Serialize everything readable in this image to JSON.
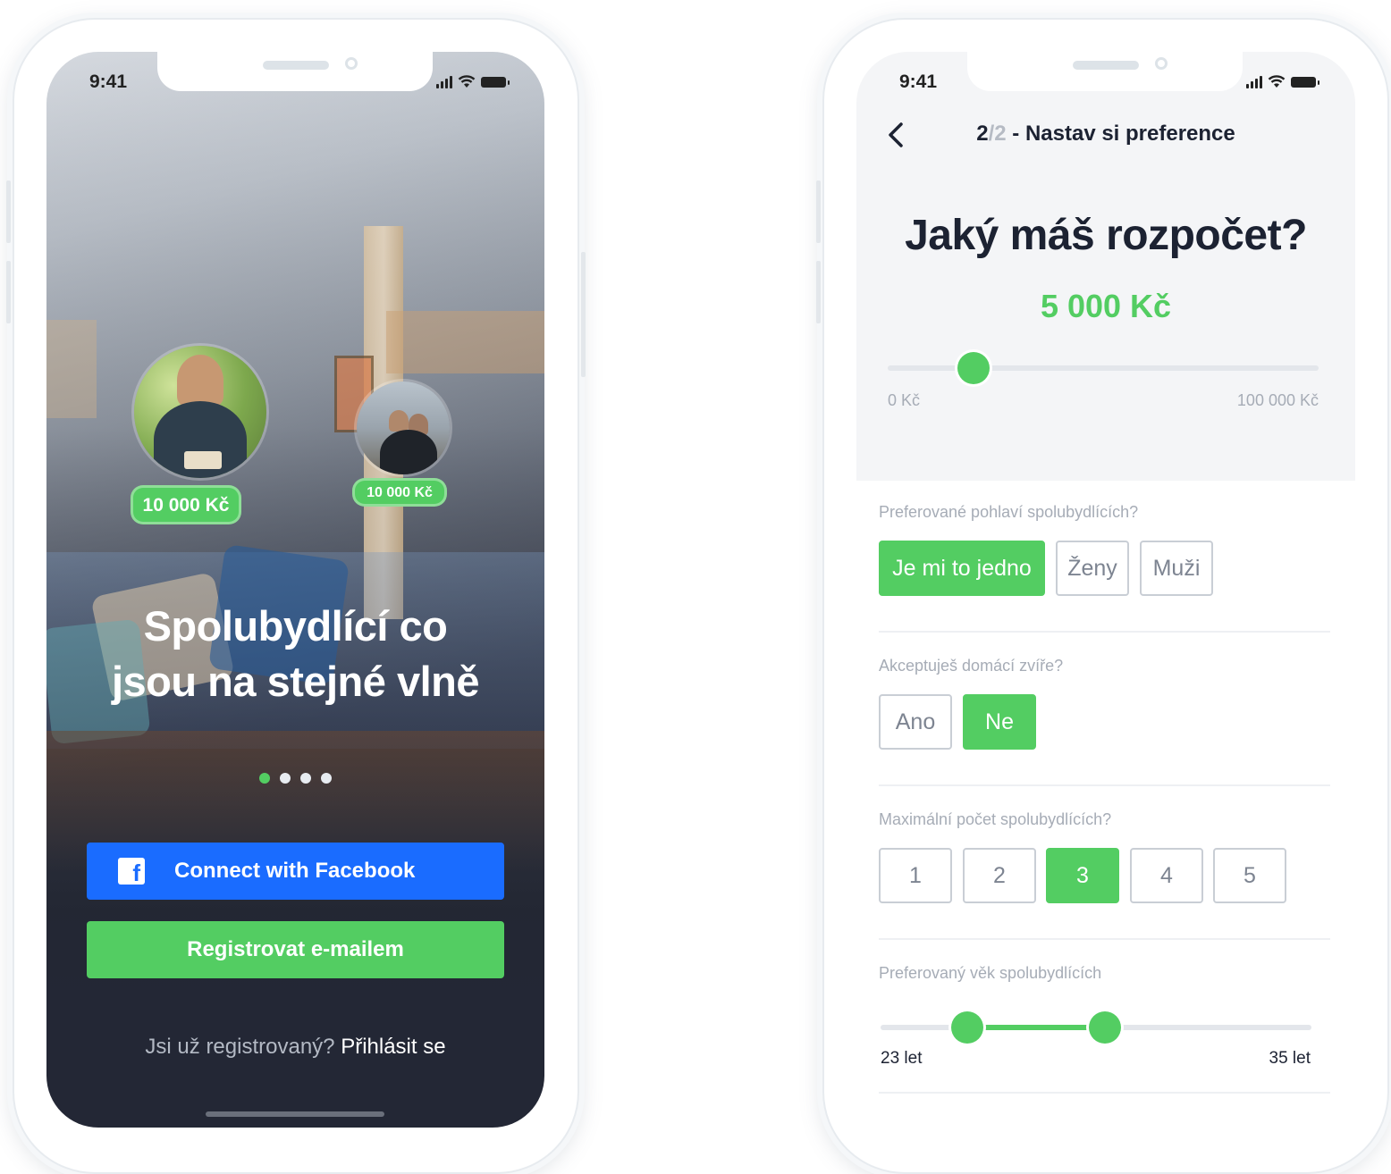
{
  "left_screen": {
    "status": {
      "time": "9:41"
    },
    "profiles": [
      {
        "price": "10 000 Kč"
      },
      {
        "price": "10 000 Kč"
      }
    ],
    "headline_lines": [
      "Spolubydlící co",
      "jsou na stejné vlně"
    ],
    "pager": {
      "count": 4,
      "active_index": 0
    },
    "facebook_button": {
      "icon": "facebook-icon",
      "label": "Connect with Facebook"
    },
    "email_button": {
      "label": "Registrovat e-mailem"
    },
    "login": {
      "question": "Jsi už registrovaný?",
      "link": "Přihlásit se"
    }
  },
  "right_screen": {
    "status": {
      "time": "9:41"
    },
    "nav": {
      "back_icon": "chevron-left-icon",
      "step_current": "2",
      "step_separator_total": "/2",
      "title": " - Nastav si preference"
    },
    "question": "Jaký máš rozpočet?",
    "budget_value": "5 000 Kč",
    "budget_slider": {
      "min_label": "0 Kč",
      "max_label": "100 000 Kč",
      "value": 5000,
      "min": 0,
      "max": 100000
    },
    "gender": {
      "label": "Preferované pohlaví spolubydlících?",
      "options": [
        "Je mi to jedno",
        "Ženy",
        "Muži"
      ],
      "selected": "Je mi to jedno"
    },
    "pets": {
      "label": "Akceptuješ domácí zvíře?",
      "options": [
        "Ano",
        "Ne"
      ],
      "selected": "Ne"
    },
    "max_roommates": {
      "label": "Maximální počet spolubydlících?",
      "options": [
        "1",
        "2",
        "3",
        "4",
        "5"
      ],
      "selected": "3"
    },
    "age": {
      "label": "Preferovaný věk spolubydlících",
      "min_label": "23 let",
      "max_label": "35 let",
      "low": 23,
      "high": 35
    }
  },
  "colors": {
    "accent_green": "#53cd62",
    "facebook_blue": "#1a6cff",
    "dark_text": "#1c2232",
    "muted_text": "#a6acb6"
  }
}
